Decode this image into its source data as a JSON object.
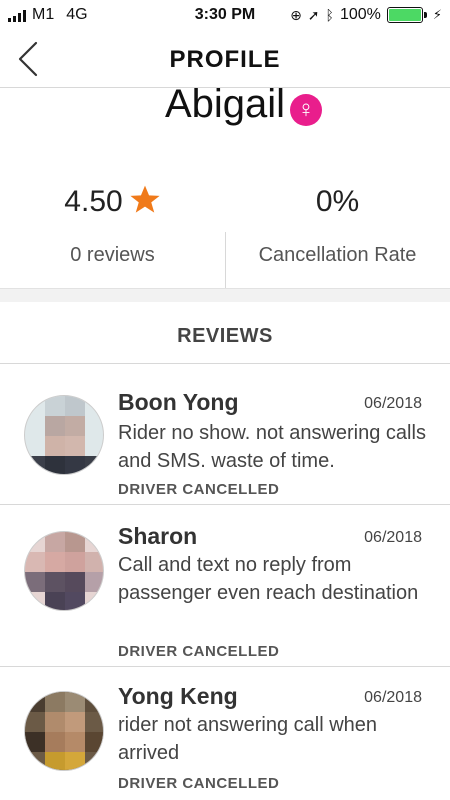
{
  "status_bar": {
    "carrier": "M1",
    "network": "4G",
    "time": "3:30 PM",
    "battery": "100%"
  },
  "header": {
    "title": "PROFILE"
  },
  "profile": {
    "name": "Abigail",
    "gender_symbol": "♀",
    "rating": "4.50",
    "reviews_count": "0 reviews",
    "cancellation_value": "0%",
    "cancellation_label": "Cancellation Rate"
  },
  "reviews_section": {
    "title": "REVIEWS",
    "items": [
      {
        "name": "Boon Yong",
        "date": "06/2018",
        "text": "Rider no show. not answering calls and SMS.  waste of time.",
        "status": "DRIVER CANCELLED"
      },
      {
        "name": "Sharon",
        "date": "06/2018",
        "text": "Call and text no reply from passenger even reach destination",
        "status": "DRIVER CANCELLED"
      },
      {
        "name": "Yong Keng",
        "date": "06/2018",
        "text": "rider not answering call when arrived",
        "status": "DRIVER CANCELLED"
      }
    ]
  },
  "colors": {
    "accent_star": "#f07a1a",
    "gender_badge": "#e91e8c",
    "battery": "#4cd964"
  },
  "icons": {
    "back": "chevron-left-icon",
    "star": "star-icon",
    "gender": "female-icon"
  }
}
